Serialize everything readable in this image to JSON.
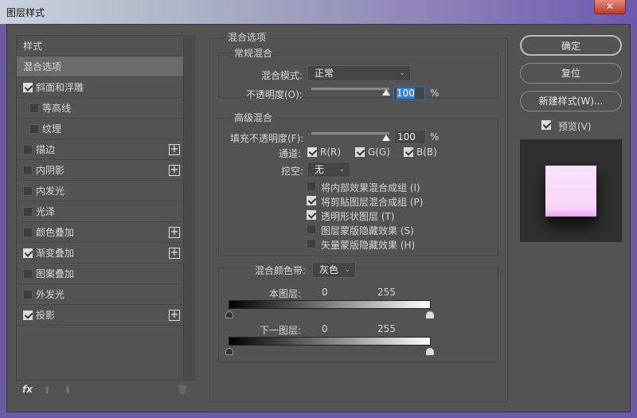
{
  "window": {
    "title": "图层样式",
    "close": "✕"
  },
  "sidebar": {
    "items": [
      {
        "label": "样式",
        "checkbox": null,
        "plus": false
      },
      {
        "label": "混合选项",
        "checkbox": null,
        "plus": false,
        "selected": true
      },
      {
        "label": "斜面和浮雕",
        "checkbox": true,
        "plus": false
      },
      {
        "label": "等高线",
        "checkbox": false,
        "plus": false,
        "indent": true
      },
      {
        "label": "纹理",
        "checkbox": false,
        "plus": false,
        "indent": true
      },
      {
        "label": "描边",
        "checkbox": false,
        "plus": true
      },
      {
        "label": "内阴影",
        "checkbox": false,
        "plus": true
      },
      {
        "label": "内发光",
        "checkbox": false,
        "plus": false
      },
      {
        "label": "光泽",
        "checkbox": false,
        "plus": false
      },
      {
        "label": "颜色叠加",
        "checkbox": false,
        "plus": true
      },
      {
        "label": "渐变叠加",
        "checkbox": true,
        "plus": true
      },
      {
        "label": "图案叠加",
        "checkbox": false,
        "plus": false
      },
      {
        "label": "外发光",
        "checkbox": false,
        "plus": false
      },
      {
        "label": "投影",
        "checkbox": true,
        "plus": true
      }
    ],
    "toolbar": {
      "fx": "fx",
      "up": "⬆",
      "down": "⬇",
      "trash": "🗑"
    }
  },
  "main": {
    "title": "混合选项",
    "general": {
      "title": "常规混合",
      "mode_label": "混合模式:",
      "mode_value": "正常",
      "opacity_label": "不透明度(O):",
      "opacity_value": "100",
      "opacity": 100,
      "percent": "%"
    },
    "advanced": {
      "title": "高级混合",
      "fill_label": "填充不透明度(F):",
      "fill_value": "100",
      "fill": 100,
      "percent": "%",
      "channels_label": "通道:",
      "channels": [
        {
          "label": "R(R)",
          "checked": true
        },
        {
          "label": "G(G)",
          "checked": true
        },
        {
          "label": "B(B)",
          "checked": true
        }
      ],
      "knockout_label": "挖空:",
      "knockout_value": "无",
      "options": [
        {
          "label": "将内部效果混合成组 (I)",
          "checked": false
        },
        {
          "label": "将剪贴图层混合成组 (P)",
          "checked": true
        },
        {
          "label": "透明形状图层 (T)",
          "checked": true
        },
        {
          "label": "图层蒙版隐藏效果 (S)",
          "checked": false
        },
        {
          "label": "矢量蒙版隐藏效果 (H)",
          "checked": false
        }
      ]
    },
    "blendif": {
      "label": "混合颜色带:",
      "value": "灰色",
      "this_layer": {
        "label": "本图层:",
        "min": "0",
        "max": "255"
      },
      "underlying": {
        "label": "下一图层:",
        "min": "0",
        "max": "255"
      }
    }
  },
  "actions": {
    "ok": "确定",
    "reset": "复位",
    "new_style": "新建样式(W)...",
    "preview_label": "预览(V)",
    "preview_checked": true
  },
  "colors": {
    "panel": "#535353",
    "preview_fill": "#f8d8fb"
  }
}
